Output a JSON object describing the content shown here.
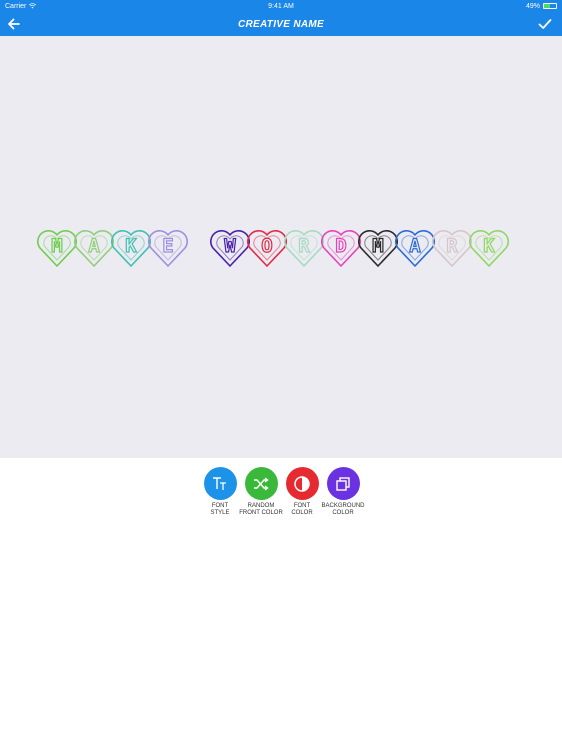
{
  "status_bar": {
    "carrier": "Carrier",
    "time": "9:41 AM",
    "battery": "49%",
    "battery_level": 0.49
  },
  "nav": {
    "title": "CREATIVE NAME",
    "back_icon": "arrow-left-icon",
    "done_icon": "checkmark-icon"
  },
  "canvas": {
    "letters": [
      {
        "char": "M",
        "color": "#6dcf4e"
      },
      {
        "char": "A",
        "color": "#8fcf7a"
      },
      {
        "char": "K",
        "color": "#3fc0b0"
      },
      {
        "char": "E",
        "color": "#9f8fdc"
      },
      {
        "char": "W",
        "color": "#4a20a8"
      },
      {
        "char": "O",
        "color": "#e22a45"
      },
      {
        "char": "R",
        "color": "#a6dbc0"
      },
      {
        "char": "D",
        "color": "#e842b8"
      },
      {
        "char": "M",
        "color": "#2a2a2a"
      },
      {
        "char": "A",
        "color": "#2a6ad8"
      },
      {
        "char": "R",
        "color": "#d6c6c8"
      },
      {
        "char": "K",
        "color": "#8fd860"
      }
    ]
  },
  "tools": [
    {
      "label": "FONT\nSTYLE",
      "color": "#1c93e8",
      "icon": "text-tt-icon"
    },
    {
      "label": "RANDOM\nFRONT COLOR",
      "color": "#3ab83a",
      "icon": "shuffle-icon"
    },
    {
      "label": "FONT\nCOLOR",
      "color": "#e52b30",
      "icon": "contrast-icon"
    },
    {
      "label": "BACKGROUND\nCOLOR",
      "color": "#6a32e0",
      "icon": "layers-icon"
    }
  ]
}
